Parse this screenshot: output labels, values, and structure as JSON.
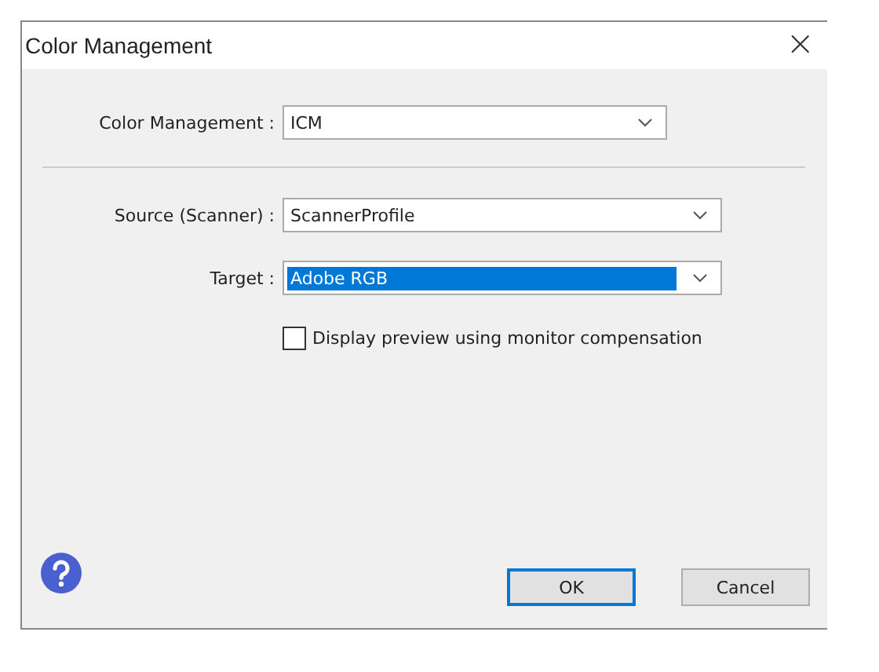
{
  "window": {
    "title": "Color Management",
    "close": "×"
  },
  "mode": {
    "label": "Color Management :",
    "value": "ICM",
    "selected": false
  },
  "fields": [
    {
      "label": "Source (Scanner) :",
      "value": "ScannerProfile",
      "selected": false
    },
    {
      "label": "Target :",
      "value": "Adobe RGB",
      "selected": true
    }
  ],
  "checkbox": {
    "label": "Display preview using monitor compensation",
    "checked": false
  },
  "buttons": [
    {
      "label": "OK",
      "default": true
    },
    {
      "label": "Cancel",
      "default": false
    }
  ]
}
